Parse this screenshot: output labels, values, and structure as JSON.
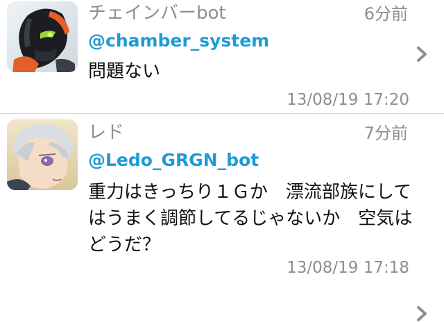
{
  "tweets": [
    {
      "name": "チェインバーbot",
      "time": "6分前",
      "handle": "@chamber_system",
      "text": "問題ない",
      "date": "13/08/19 17:20",
      "avatar_icon": "robot-avatar"
    },
    {
      "name": "レド",
      "time": "7分前",
      "handle": "@Ledo_GRGN_bot",
      "text": "重力はきっちり１Ｇか　漂流部族にしてはうまく調節してるじゃないか　空気はどうだ？",
      "date": "13/08/19 17:18",
      "avatar_icon": "character-avatar"
    }
  ],
  "colors": {
    "handle": "#1e9bd7",
    "meta": "#8e8e8e",
    "text": "#111111",
    "divider": "#d7d7d7"
  }
}
